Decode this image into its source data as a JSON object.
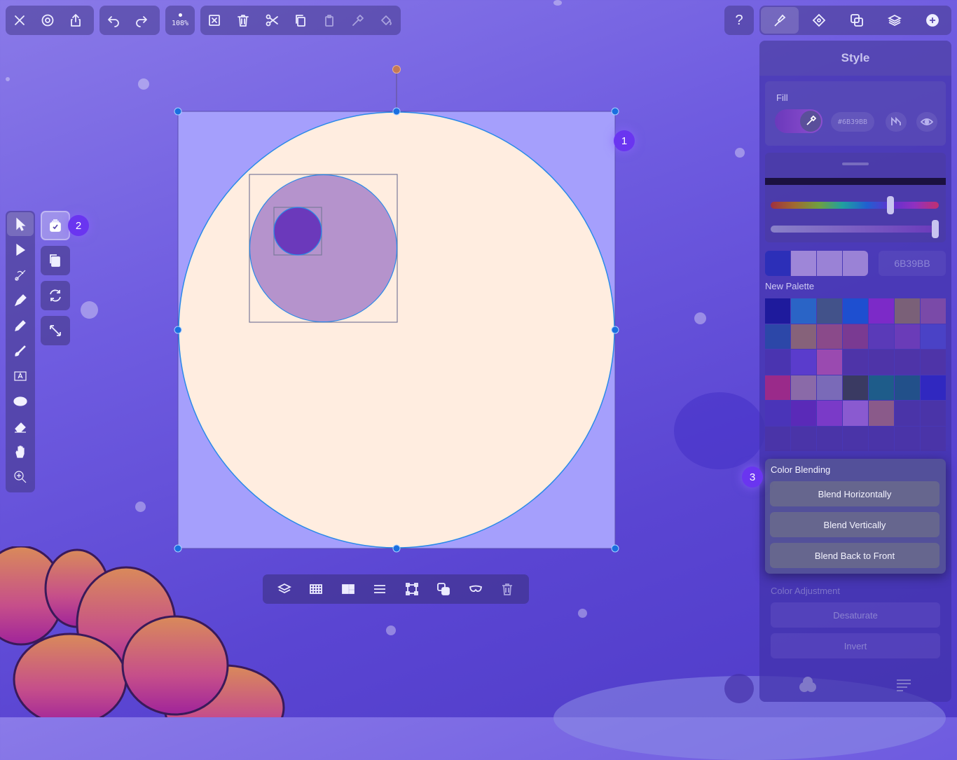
{
  "toolbar": {
    "zoom_label": "108%"
  },
  "help_label": "?",
  "canvas": {
    "artboard_badge": "1",
    "artboard_color": "#A59FFC",
    "big_circle_color": "#FFEDE0",
    "mid_circle_color": "#B593CC",
    "small_circle_color": "#6B39BB"
  },
  "side_badge": "2",
  "panel": {
    "title": "Style",
    "fill_label": "Fill",
    "fill_hex": "#6B39BB",
    "hex_field": "6B39BB",
    "palette_label": "New Palette",
    "recent_colors": [
      "#2c2fb8",
      "#9e86d8",
      "#9a82d6",
      "#9a82d6"
    ],
    "palette": [
      "#1e1a9c",
      "#2a64c6",
      "#42528a",
      "#1e4fd0",
      "#7c2ac8",
      "#7a6078",
      "#7a4aa8",
      "#2c47a8",
      "#86627a",
      "#8a4a8a",
      "#7a3a92",
      "#5a3ab8",
      "#6a3cb8",
      "#4a42c6",
      "#4a34b0",
      "#5a3ccc",
      "#9a4ab0",
      "#4e34a8",
      "#4e34a8",
      "#4e34a8",
      "#4e34a8",
      "#9a2a8a",
      "#8a6aa8",
      "#7a6ab8",
      "#3a3a62",
      "#1e5c8a",
      "#22508a",
      "#3028c0",
      "#4a34b8",
      "#5a2ab8",
      "#7a3ac8",
      "#8a5ad0",
      "#8a5a8a",
      "#4a34a8",
      "#4a34a8",
      "#4a34a8",
      "#4a34a8",
      "#4a34a8",
      "#4a34a8",
      "#4a34a8",
      "#4a34a8",
      "#4a34a8"
    ],
    "blending": {
      "badge": "3",
      "title": "Color Blending",
      "buttons": [
        "Blend Horizontally",
        "Blend Vertically",
        "Blend Back to Front"
      ]
    },
    "adjustment": {
      "title": "Color Adjustment",
      "buttons": [
        "Desaturate",
        "Invert"
      ]
    }
  }
}
